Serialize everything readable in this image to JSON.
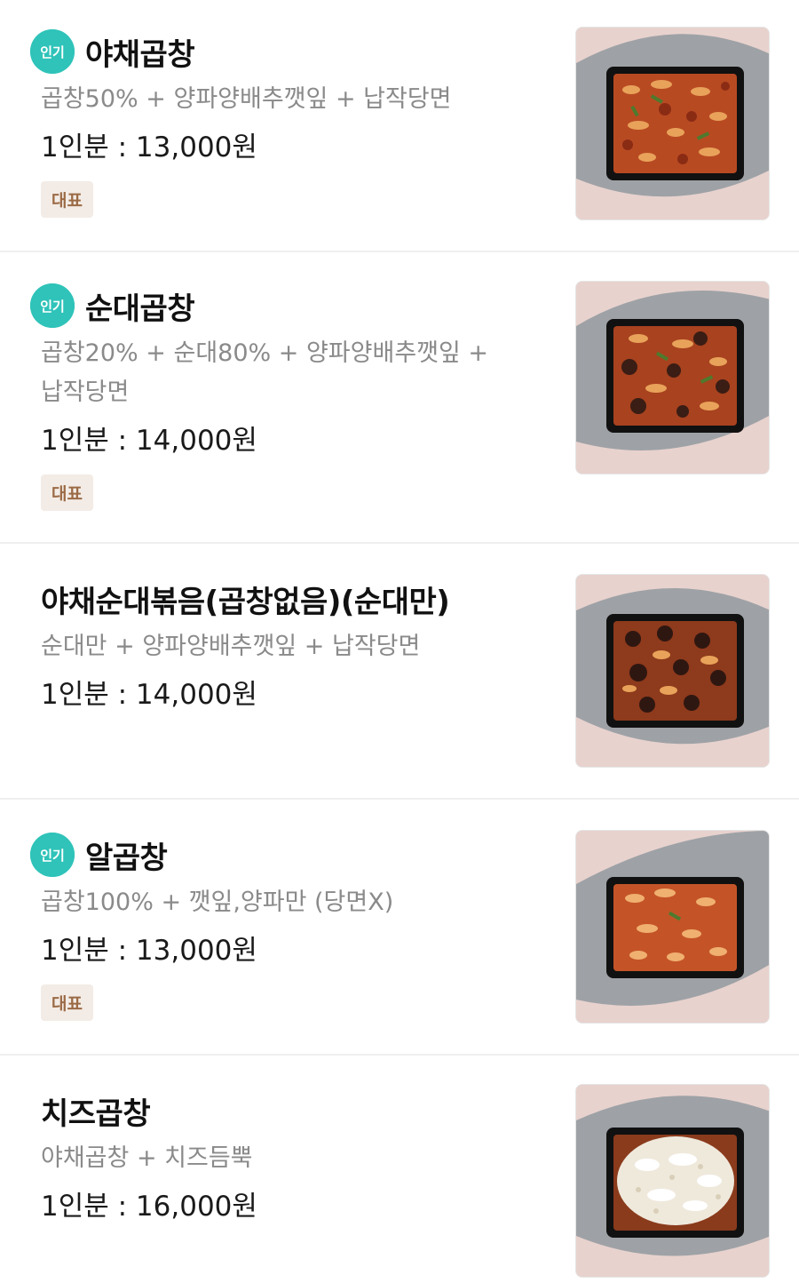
{
  "menu": {
    "items": [
      {
        "popular_label": "인기",
        "name": "야채곱창",
        "desc_lines": [
          "곱창50% + 양파양배추깻잎 + 납작당면"
        ],
        "price": "1인분 : 13,000원",
        "tag": "대표",
        "image_icon": "stir-fried-gopchang-photo"
      },
      {
        "popular_label": "인기",
        "name": "순대곱창",
        "desc_lines": [
          "곱창20% + 순대80% + 양파양배추깻잎 +",
          "납작당면"
        ],
        "price": "1인분 : 14,000원",
        "tag": "대표",
        "image_icon": "sundae-gopchang-photo"
      },
      {
        "name": "야채순대볶음(곱창없음)(순대만)",
        "desc_lines": [
          "순대만 + 양파양배추깻잎 + 납작당면"
        ],
        "price": "1인분 : 14,000원",
        "image_icon": "sundae-bokkeum-photo"
      },
      {
        "popular_label": "인기",
        "name": "알곱창",
        "desc_lines": [
          "곱창100% + 깻잎,양파만 (당면X)"
        ],
        "price": "1인분 : 13,000원",
        "tag": "대표",
        "image_icon": "al-gopchang-photo"
      },
      {
        "name": "치즈곱창",
        "desc_lines": [
          "야채곱창 + 치즈듬뿍"
        ],
        "price": "1인분 : 16,000원",
        "image_icon": "cheese-gopchang-photo"
      }
    ]
  },
  "colors": {
    "popular_badge": "#2fc3b9",
    "tag_bg": "#f3ece6",
    "tag_text": "#9b6a45",
    "desc_text": "#8a8a8a",
    "divider": "#efefef"
  }
}
